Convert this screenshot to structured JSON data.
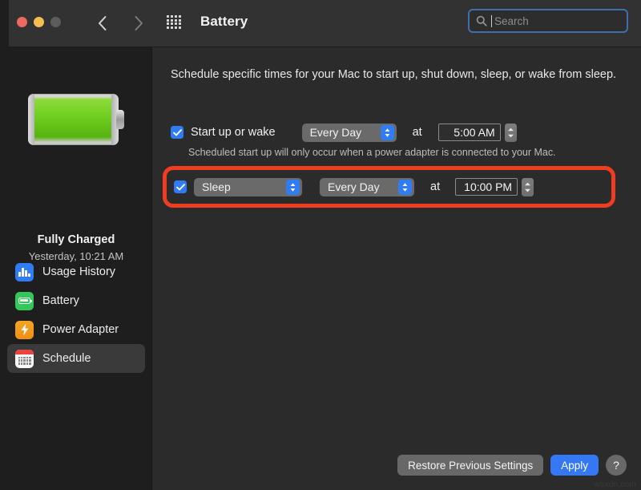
{
  "window": {
    "title": "Battery",
    "traffic_lights": [
      "close",
      "minimize",
      "zoom"
    ]
  },
  "toolbar": {
    "back_icon": "chevron-left-icon",
    "forward_icon": "chevron-right-icon",
    "grid_icon": "show-all-preferences-icon"
  },
  "search": {
    "placeholder": "Search",
    "value": "",
    "icon": "search-icon"
  },
  "sidebar": {
    "battery_icon": "battery-full-green-icon",
    "status": "Fully Charged",
    "substatus": "Yesterday, 10:21 AM",
    "items": [
      {
        "label": "Usage History",
        "icon": "usage-history-icon",
        "selected": false
      },
      {
        "label": "Battery",
        "icon": "battery-icon",
        "selected": false
      },
      {
        "label": "Power Adapter",
        "icon": "power-adapter-icon",
        "selected": false
      },
      {
        "label": "Schedule",
        "icon": "schedule-calendar-icon",
        "selected": true
      }
    ]
  },
  "main": {
    "intro": "Schedule specific times for your Mac to start up, shut down, sleep, or wake from sleep.",
    "startup_row": {
      "checked": true,
      "label": "Start up or wake",
      "day": "Every Day",
      "at_label": "at",
      "time": "5:00 AM"
    },
    "note": "Scheduled start up will only occur when a power adapter is connected to your Mac.",
    "sleep_row": {
      "checked": true,
      "action": "Sleep",
      "day": "Every Day",
      "at_label": "at",
      "time": "10:00 PM",
      "highlighted": true
    }
  },
  "footer": {
    "restore_label": "Restore Previous Settings",
    "apply_label": "Apply",
    "help_label": "?"
  },
  "watermark": "wsxdn.com",
  "colors": {
    "accent_blue": "#3478f6",
    "annotation_red": "#ef3d22",
    "battery_green": "#63c118",
    "window_bg": "#2b2b2b",
    "sidebar_bg": "#1e1e1e",
    "titlebar_bg": "#323232"
  }
}
